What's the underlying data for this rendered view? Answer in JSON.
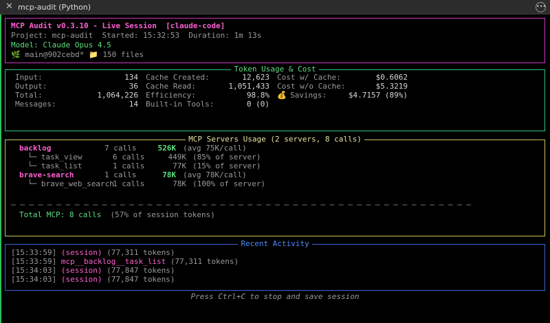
{
  "window": {
    "title": "mcp-audit (Python)"
  },
  "header": {
    "title": "MCP Audit v0.3.10 - Live Session",
    "tag": "[claude-code]",
    "project_line": "Project: mcp-audit  Started: 15:32:53  Duration: 1m 13s",
    "model_line": "Model: Claude Opus 4.5",
    "git_icon": "🌿",
    "branch": "main@902cebd*",
    "folder_icon": "📁",
    "files": "150 files"
  },
  "tokens": {
    "title": "Token Usage & Cost",
    "col1": [
      {
        "label": "Input:",
        "value": "134"
      },
      {
        "label": "Output:",
        "value": "36"
      },
      {
        "label": "Total:",
        "value": "1,064,226"
      },
      {
        "label": "Messages:",
        "value": "14"
      }
    ],
    "col2": [
      {
        "label": "Cache Created:",
        "value": "12,623"
      },
      {
        "label": "Cache Read:",
        "value": "1,051,433"
      },
      {
        "label": "Efficiency:",
        "value": "98.8%"
      },
      {
        "label": "Built-in Tools:",
        "value": "0 (0)"
      }
    ],
    "col3": [
      {
        "label": "Cost w/ Cache:",
        "value": "$0.6062"
      },
      {
        "label": "Cost w/o Cache:",
        "value": "$5.3219"
      },
      {
        "label": "Savings:",
        "value": "$4.7157 (89%)",
        "icon": "💰"
      }
    ]
  },
  "mcp": {
    "title": "MCP Servers Usage (2 servers, 8 calls)",
    "rows": [
      {
        "name": "backlog",
        "calls": "7 calls",
        "tokens": "526K",
        "note": "(avg 75K/call)"
      },
      {
        "name": "└─ task_view",
        "calls": "6 calls",
        "tokens": "449K",
        "note": "(85% of server)"
      },
      {
        "name": "└─ task_list",
        "calls": "1 calls",
        "tokens": "77K",
        "note": "(15% of server)"
      },
      {
        "name": "brave-search",
        "calls": "1 calls",
        "tokens": "78K",
        "note": "(avg 78K/call)"
      },
      {
        "name": "└─ brave_web_search",
        "calls": "1 calls",
        "tokens": "78K",
        "note": "(100% of server)"
      }
    ],
    "separator": "─ ─ ─ ─ ─ ─ ─ ─ ─ ─ ─ ─ ─ ─ ─ ─ ─ ─ ─ ─ ─ ─ ─ ─ ─ ─ ─ ─ ─ ─ ─ ─ ─ ─ ─ ─ ─ ─ ─ ─ ─ ─ ─ ─ ─ ─ ─ ─ ─ ─ ─",
    "total_label": "Total MCP: 8 calls",
    "total_note": "(57% of session tokens)"
  },
  "activity": {
    "title": "Recent Activity",
    "items": [
      {
        "time": "[15:33:59]",
        "name": "(session)",
        "tokens": "(77,311 tokens)"
      },
      {
        "time": "[15:33:59]",
        "name": "mcp__backlog__task_list",
        "tokens": "(77,311 tokens)"
      },
      {
        "time": "[15:34:03]",
        "name": "(session)",
        "tokens": "(77,847 tokens)"
      },
      {
        "time": "[15:34:03]",
        "name": "(session)",
        "tokens": "(77,847 tokens)"
      }
    ]
  },
  "footer": "Press Ctrl+C to stop and save session",
  "colors": {
    "accent": "#ff5fd2",
    "green": "#5fdf80",
    "header_border": "#c93ac0",
    "token_border": "#2fc783",
    "mcp_border": "#c7c55a",
    "activity_border": "#3e62d4"
  }
}
